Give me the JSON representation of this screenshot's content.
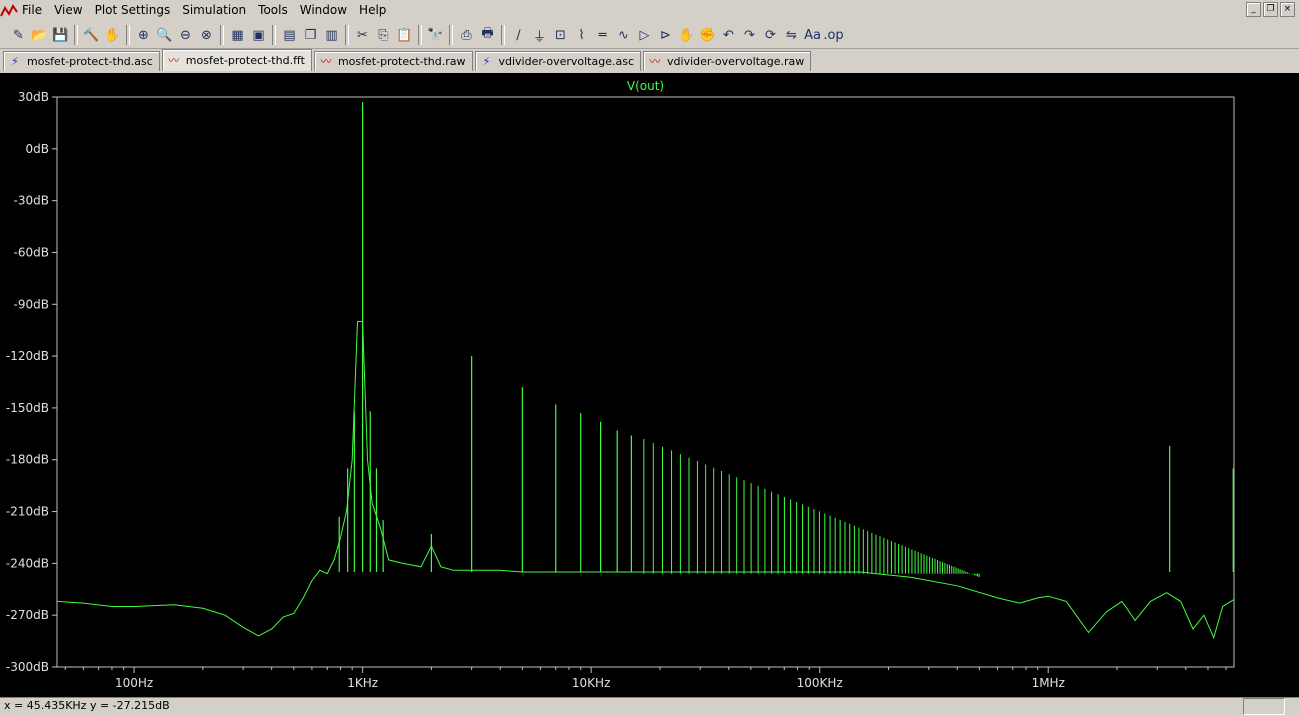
{
  "menu": [
    "File",
    "View",
    "Plot Settings",
    "Simulation",
    "Tools",
    "Window",
    "Help"
  ],
  "window_buttons": [
    "_",
    "❐",
    "×"
  ],
  "toolbar": [
    "new-schematic",
    "open",
    "save",
    "control-panel",
    "pan",
    "zoom-in",
    "zoom-area",
    "zoom-out",
    "cancel-zoom",
    "autorange",
    "zoom-fit",
    "tile-horizontal",
    "cascade",
    "tile",
    "cut",
    "copy",
    "paste",
    "find",
    "print-preview",
    "print",
    "wire",
    "ground",
    "label",
    "resistor",
    "capacitor",
    "inductor",
    "diode",
    "component",
    "move",
    "drag",
    "undo",
    "redo",
    "rotate",
    "mirror",
    "text",
    "spice-directive"
  ],
  "tabs": [
    {
      "label": "mosfet-protect-thd.asc",
      "kind": "schematic"
    },
    {
      "label": "mosfet-protect-thd.fft",
      "kind": "waveform",
      "active": true
    },
    {
      "label": "mosfet-protect-thd.raw",
      "kind": "waveform"
    },
    {
      "label": "vdivider-overvoltage.asc",
      "kind": "schematic"
    },
    {
      "label": "vdivider-overvoltage.raw",
      "kind": "waveform"
    }
  ],
  "status": {
    "text": "x = 45.435KHz    y = -27.215dB"
  },
  "colors": {
    "trace": "#40ff40",
    "axis_frame": "#c0c0c0",
    "labels": "#e0e0e0",
    "background": "#000000"
  },
  "chart_data": {
    "type": "line",
    "title": "V(out)",
    "x_scale": "log",
    "xlim": [
      46,
      6500000
    ],
    "ylim": [
      -300,
      30
    ],
    "y_ticks": [
      {
        "v": 30,
        "label": "30dB"
      },
      {
        "v": 0,
        "label": "0dB"
      },
      {
        "v": -30,
        "label": "-30dB"
      },
      {
        "v": -60,
        "label": "-60dB"
      },
      {
        "v": -90,
        "label": "-90dB"
      },
      {
        "v": -120,
        "label": "-120dB"
      },
      {
        "v": -150,
        "label": "-150dB"
      },
      {
        "v": -180,
        "label": "-180dB"
      },
      {
        "v": -210,
        "label": "-210dB"
      },
      {
        "v": -240,
        "label": "-240dB"
      },
      {
        "v": -270,
        "label": "-270dB"
      },
      {
        "v": -300,
        "label": "-300dB"
      }
    ],
    "x_ticks": [
      {
        "v": 100,
        "label": "100Hz"
      },
      {
        "v": 1000,
        "label": "1KHz"
      },
      {
        "v": 10000,
        "label": "10KHz"
      },
      {
        "v": 100000,
        "label": "100KHz"
      },
      {
        "v": 1000000,
        "label": "1MHz"
      }
    ],
    "baseline": [
      [
        46,
        -262
      ],
      [
        60,
        -263
      ],
      [
        80,
        -265
      ],
      [
        100,
        -265
      ],
      [
        150,
        -264
      ],
      [
        200,
        -266
      ],
      [
        250,
        -270
      ],
      [
        300,
        -277
      ],
      [
        350,
        -282
      ],
      [
        400,
        -278
      ],
      [
        450,
        -271
      ],
      [
        500,
        -269
      ],
      [
        550,
        -260
      ],
      [
        600,
        -250
      ],
      [
        650,
        -244
      ],
      [
        700,
        -246
      ],
      [
        750,
        -238
      ],
      [
        800,
        -225
      ],
      [
        850,
        -210
      ],
      [
        900,
        -180
      ],
      [
        950,
        -100
      ],
      [
        1000,
        -100
      ],
      [
        1050,
        -180
      ],
      [
        1100,
        -205
      ],
      [
        1200,
        -220
      ],
      [
        1300,
        -238
      ],
      [
        1500,
        -240
      ],
      [
        1800,
        -242
      ],
      [
        2000,
        -230
      ],
      [
        2200,
        -242
      ],
      [
        2500,
        -244
      ],
      [
        3000,
        -244
      ],
      [
        4000,
        -244
      ],
      [
        5000,
        -245
      ],
      [
        7000,
        -245
      ],
      [
        10000,
        -245
      ],
      [
        20000,
        -245
      ],
      [
        40000,
        -245
      ],
      [
        80000,
        -245
      ],
      [
        150000,
        -245
      ],
      [
        250000,
        -248
      ],
      [
        400000,
        -253
      ],
      [
        600000,
        -260
      ],
      [
        750000,
        -263
      ],
      [
        900000,
        -260
      ],
      [
        1000000,
        -259
      ],
      [
        1200000,
        -262
      ],
      [
        1500000,
        -280
      ],
      [
        1800000,
        -268
      ],
      [
        2100000,
        -262
      ],
      [
        2400000,
        -273
      ],
      [
        2800000,
        -262
      ],
      [
        3300000,
        -257
      ],
      [
        3800000,
        -262
      ],
      [
        4300000,
        -278
      ],
      [
        4800000,
        -270
      ],
      [
        5300000,
        -283
      ],
      [
        5800000,
        -265
      ],
      [
        6500000,
        -261
      ]
    ],
    "peaks": [
      {
        "x": 1000,
        "y": 27
      },
      {
        "x": 920,
        "y": -152
      },
      {
        "x": 1080,
        "y": -152
      },
      {
        "x": 860,
        "y": -185
      },
      {
        "x": 1150,
        "y": -185
      },
      {
        "x": 790,
        "y": -213
      },
      {
        "x": 1230,
        "y": -215
      },
      {
        "x": 2000,
        "y": -223
      },
      {
        "x": 3000,
        "y": -120
      },
      {
        "x": 5000,
        "y": -138
      },
      {
        "x": 7000,
        "y": -148
      },
      {
        "x": 9000,
        "y": -153
      },
      {
        "x": 11000,
        "y": -158
      },
      {
        "x": 13000,
        "y": -163
      },
      {
        "x": 15000,
        "y": -166
      },
      {
        "x": 3400000,
        "y": -172
      },
      {
        "x": 6450000,
        "y": -185
      }
    ],
    "comb": {
      "start": 17000,
      "end": 500000,
      "step_factor": 1.1,
      "y_start": -168,
      "y_end": -248
    }
  }
}
